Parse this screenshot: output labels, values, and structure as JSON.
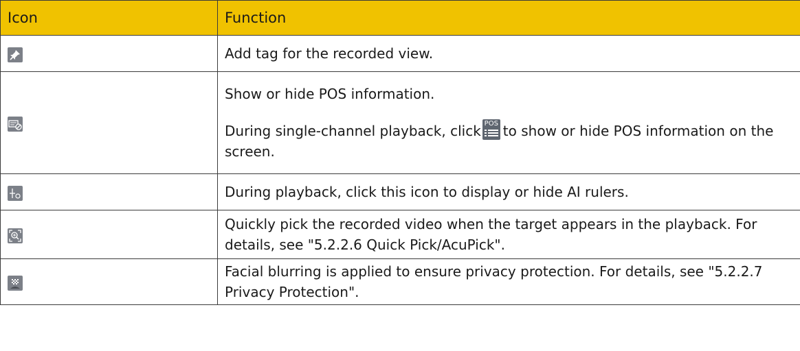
{
  "table": {
    "headers": [
      "Icon",
      "Function"
    ],
    "rows": [
      {
        "icon": "pin-icon",
        "lines": [
          "Add tag for the recorded view."
        ]
      },
      {
        "icon": "pos-hide-icon",
        "lines": [
          "Show or hide POS information.",
          "During single-channel playback, click",
          "to show or hide POS information on the screen."
        ],
        "inline_icon": {
          "name": "pos-icon",
          "label": "POS"
        }
      },
      {
        "icon": "ai-ruler-icon",
        "lines": [
          "During playback, click this icon to display or hide AI rulers."
        ]
      },
      {
        "icon": "quick-pick-icon",
        "lines": [
          "Quickly pick the recorded video when the target appears in the playback. For details, see \"5.2.2.6 Quick Pick/AcuPick\"."
        ]
      },
      {
        "icon": "privacy-blur-icon",
        "lines": [
          "Facial blurring is applied to ensure privacy protection. For details, see \"5.2.2.7 Privacy Protection\"."
        ]
      }
    ]
  }
}
